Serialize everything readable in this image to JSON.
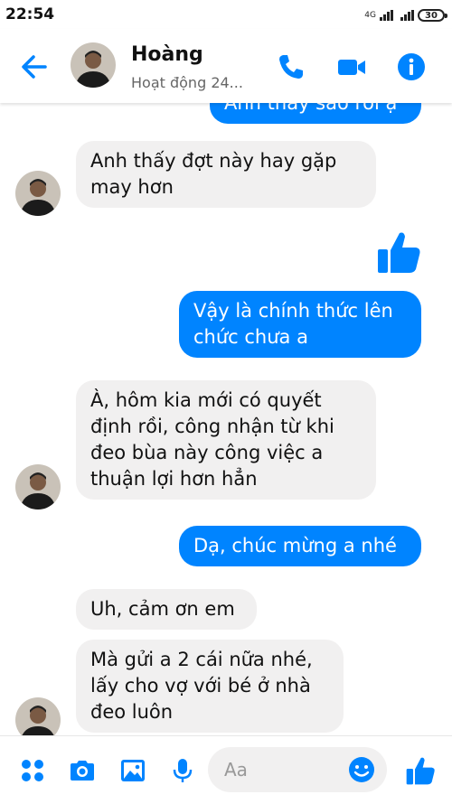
{
  "status_bar": {
    "time": "22:54",
    "network": "4G",
    "battery": "30"
  },
  "header": {
    "contact_name": "Hoàng",
    "active_status": "Hoạt động 24..."
  },
  "messages": [
    {
      "from": "me",
      "text": "Anh thấy sao rồi ạ"
    },
    {
      "from": "them",
      "text": "Anh thấy đợt này hay gặp\nmay hơn"
    },
    {
      "from": "me",
      "type": "like"
    },
    {
      "from": "me",
      "text": "Vậy là chính thức lên\nchức chưa a"
    },
    {
      "from": "them",
      "text": "À, hôm kia mới có quyết\nđịnh rồi, công nhận từ khi\nđeo bùa này công việc a\nthuận lợi hơn hẳn"
    },
    {
      "from": "me",
      "text": "Dạ, chúc mừng a nhé"
    },
    {
      "from": "them",
      "text": "Uh, cảm ơn em"
    },
    {
      "from": "them",
      "text": "Mà gửi a 2 cái nữa nhé,\nlấy cho vợ với bé ở nhà\nđeo luôn"
    }
  ],
  "composer": {
    "placeholder": "Aa"
  },
  "colors": {
    "accent": "#0084ff",
    "incoming_bubble": "#f1f0f0",
    "text": "#111111"
  },
  "icons": [
    "back-arrow-icon",
    "phone-icon",
    "video-call-icon",
    "info-icon",
    "apps-grid-icon",
    "camera-icon",
    "image-icon",
    "microphone-icon",
    "emoji-icon",
    "thumbs-up-icon"
  ]
}
